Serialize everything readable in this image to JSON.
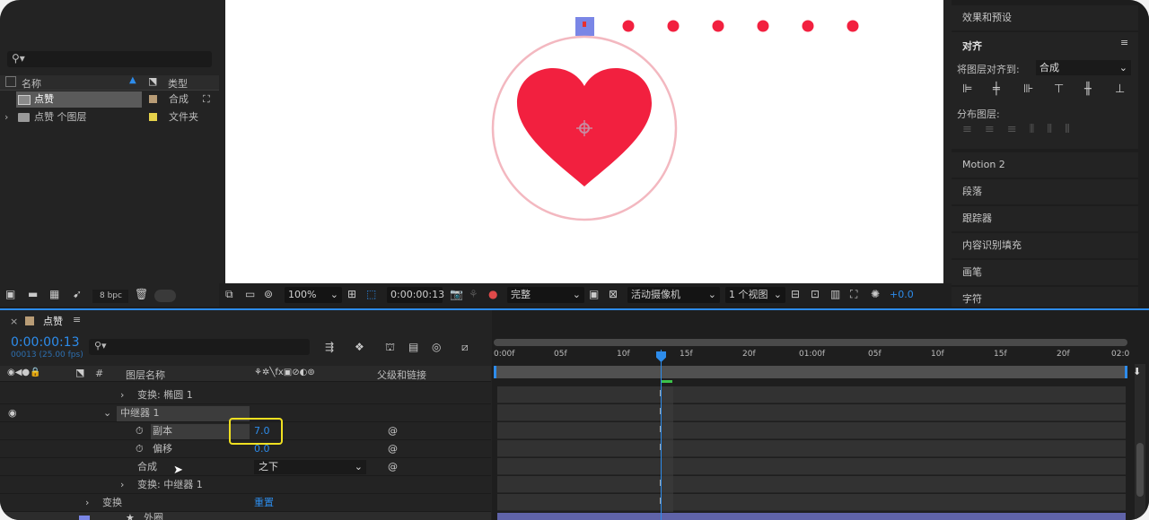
{
  "project": {
    "col_name": "名称",
    "col_type": "类型",
    "items": [
      {
        "name": "点赞",
        "type": "合成",
        "swatch": "#b89c76"
      },
      {
        "name": "点赞 个图层",
        "type": "文件夹",
        "swatch": "#e6d24a"
      }
    ],
    "bpc": "8 bpc"
  },
  "viewer": {
    "zoom": "100%",
    "timecode": "0:00:00:13",
    "resolution": "完整",
    "camera": "活动摄像机",
    "views": "1 个视图",
    "exposure": "+0.0",
    "heart_color": "#f2203f",
    "ring_color": "#f3b8c0",
    "dot_color": "#f2203f"
  },
  "right_panel": {
    "effects": "效果和预设",
    "align_title": "对齐",
    "align_to_label": "将图层对齐到:",
    "align_to_value": "合成",
    "distribute_label": "分布图层:",
    "items": [
      "Motion 2",
      "段落",
      "跟踪器",
      "内容识别填充",
      "画笔",
      "字符"
    ]
  },
  "timeline": {
    "comp_tab": "点赞",
    "timecode": "0:00:00:13",
    "fps": "00013 (25.00 fps)",
    "col_layer_name": "图层名称",
    "col_parent": "父级和链接",
    "rows": {
      "transform_ellipse": "变换: 椭圆 1",
      "repeater": "中继器 1",
      "copies_label": "副本",
      "copies_value": "7.0",
      "offset_label": "偏移",
      "offset_value": "0.0",
      "composite_label": "合成",
      "composite_value": "之下",
      "transform_repeater": "变换: 中继器 1",
      "transform": "变换",
      "reset": "重置",
      "next_layer": "外圈"
    },
    "ruler": [
      "0:00f",
      "05f",
      "10f",
      "15f",
      "20f",
      "01:00f",
      "05f",
      "10f",
      "15f",
      "20f",
      "02:0"
    ],
    "accent": "#2d8ceb",
    "highlight": "#f0e020"
  }
}
